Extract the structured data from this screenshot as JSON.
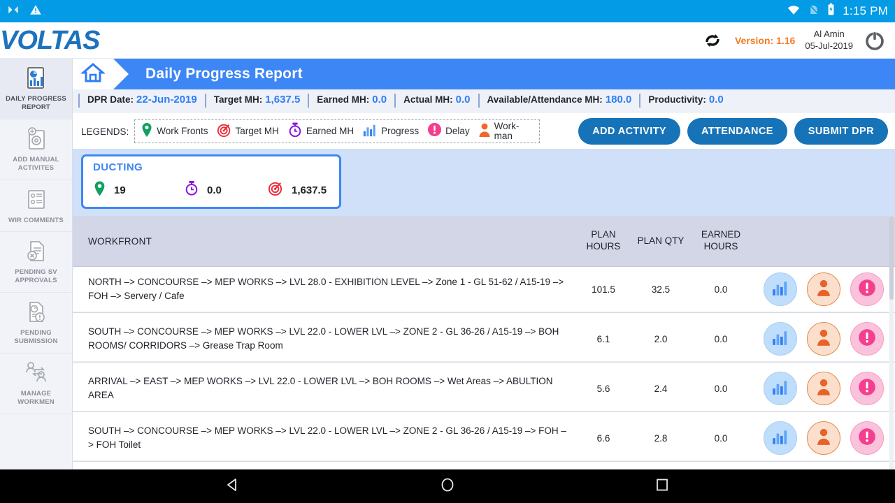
{
  "status_bar": {
    "time": "1:15 PM",
    "icons": [
      "notification-n-icon",
      "warning-icon",
      "wifi-icon",
      "sim-icon",
      "battery-charging-icon"
    ]
  },
  "brand": {
    "logo_text": "VOLTAS",
    "sync_icon": "sync-icon",
    "version": "Version: 1.16",
    "user_name": "Al Amin",
    "user_date": "05-Jul-2019",
    "power_icon": "power-icon"
  },
  "sidebar": {
    "items": [
      {
        "label": "DAILY PROGRESS REPORT",
        "icon": "report-chart-doc-icon",
        "active": true
      },
      {
        "label": "ADD MANUAL ACTIVITES",
        "icon": "add-gear-doc-icon",
        "active": false
      },
      {
        "label": "WIR COMMENTS",
        "icon": "people-list-doc-icon",
        "active": false
      },
      {
        "label": "PENDING SV APPROVALS",
        "icon": "doc-cross-icon",
        "active": false
      },
      {
        "label": "PENDING SUBMISSION",
        "icon": "doc-pie-alert-icon",
        "active": false
      },
      {
        "label": "MANAGE WORKMEN",
        "icon": "manage-workmen-icon",
        "active": false
      }
    ]
  },
  "header": {
    "home_icon": "home-icon",
    "title": "Daily Progress Report"
  },
  "kpis": [
    {
      "label": "DPR Date:",
      "value": "22-Jun-2019"
    },
    {
      "label": "Target MH:",
      "value": "1,637.5"
    },
    {
      "label": "Earned MH:",
      "value": "0.0"
    },
    {
      "label": "Actual MH:",
      "value": "0.0"
    },
    {
      "label": "Available/Attendance MH:",
      "value": "180.0"
    },
    {
      "label": "Productivity:",
      "value": "0.0"
    }
  ],
  "legends": {
    "title": "LEGENDS:",
    "items": [
      {
        "label": "Work Fronts",
        "icon": "location-pin-icon",
        "color": "#11A05E"
      },
      {
        "label": "Target MH",
        "icon": "target-icon",
        "color": "#EE2B3A"
      },
      {
        "label": "Earned MH",
        "icon": "stopwatch-icon",
        "color": "#8A17E0"
      },
      {
        "label": "Progress",
        "icon": "bar-chart-icon",
        "color": "#3D86F5"
      },
      {
        "label": "Delay",
        "icon": "alert-circle-icon",
        "color": "#F43F8E"
      },
      {
        "label": "Work-man",
        "icon": "workman-icon",
        "color": "#F1662A"
      }
    ]
  },
  "toolbar": {
    "add_activity_label": "ADD ACTIVITY",
    "attendance_label": "ATTENDANCE",
    "submit_dpr_label": "SUBMIT DPR"
  },
  "card": {
    "title": "DUCTING",
    "work_fronts": "19",
    "earned_mh": "0.0",
    "target_mh": "1,637.5"
  },
  "table": {
    "columns": {
      "workfront": "WORKFRONT",
      "plan_hours_l1": "PLAN",
      "plan_hours_l2": "HOURS",
      "plan_qty": "PLAN QTY",
      "earned_hours_l1": "EARNED",
      "earned_hours_l2": "HOURS"
    },
    "rows": [
      {
        "workfront": "NORTH –> CONCOURSE –> MEP WORKS –> LVL 28.0 - EXHIBITION LEVEL –> Zone 1 - GL 51-62 / A15-19 –> FOH –> Servery / Cafe",
        "plan_hours": "101.5",
        "plan_qty": "32.5",
        "earned_hours": "0.0"
      },
      {
        "workfront": "SOUTH –> CONCOURSE –> MEP WORKS –> LVL 22.0 - LOWER LVL –> ZONE 2 - GL 36-26 / A15-19 –> BOH ROOMS/ CORRIDORS –> Grease Trap Room",
        "plan_hours": "6.1",
        "plan_qty": "2.0",
        "earned_hours": "0.0"
      },
      {
        "workfront": "ARRIVAL –> EAST –> MEP WORKS –> LVL 22.0 - LOWER LVL –> BOH ROOMS –> Wet Areas –> ABULTION AREA",
        "plan_hours": "5.6",
        "plan_qty": "2.4",
        "earned_hours": "0.0"
      },
      {
        "workfront": "SOUTH –> CONCOURSE –> MEP WORKS –> LVL 22.0 - LOWER LVL –> ZONE 2 - GL 36-26 / A15-19 –> FOH –> FOH Toilet",
        "plan_hours": "6.6",
        "plan_qty": "2.8",
        "earned_hours": "0.0"
      }
    ],
    "row_actions": [
      {
        "name": "progress-button",
        "icon": "bar-chart-icon"
      },
      {
        "name": "workman-button",
        "icon": "workman-icon"
      },
      {
        "name": "delay-button",
        "icon": "alert-circle-icon"
      }
    ]
  },
  "nav_bar": {
    "back": "back-triangle-icon",
    "home": "home-circle-icon",
    "recents": "recents-square-icon"
  }
}
